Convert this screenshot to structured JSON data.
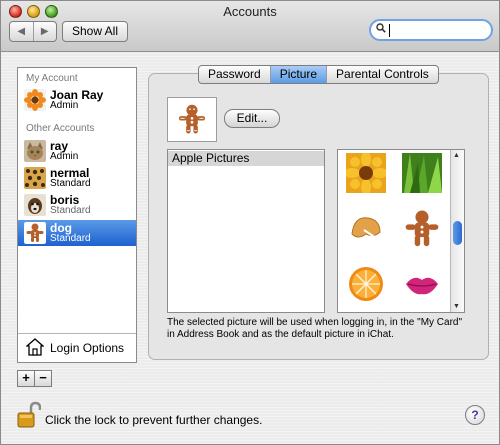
{
  "window": {
    "title": "Accounts"
  },
  "toolbar": {
    "back": "◀",
    "forward": "▶",
    "show_all": "Show All",
    "search_placeholder": ""
  },
  "sidebar": {
    "my_account_header": "My Account",
    "other_accounts_header": "Other Accounts",
    "my_account": {
      "name": "Joan Ray",
      "role": "Admin"
    },
    "accounts": [
      {
        "name": "ray",
        "role": "Admin"
      },
      {
        "name": "nermal",
        "role": "Standard"
      },
      {
        "name": "boris",
        "role": "Standard"
      },
      {
        "name": "dog",
        "role": "Standard",
        "selected": true
      }
    ],
    "login_options": "Login Options",
    "add": "+",
    "remove": "−"
  },
  "tabs": [
    {
      "label": "Password",
      "active": false
    },
    {
      "label": "Picture",
      "active": true
    },
    {
      "label": "Parental Controls",
      "active": false
    }
  ],
  "picture": {
    "edit_label": "Edit...",
    "source_list": [
      "Apple Pictures"
    ],
    "images": [
      "sunflower",
      "grass",
      "fortune-cookie",
      "gingerbread-man",
      "orange-slice",
      "lips"
    ],
    "note": "The selected picture will be used when logging in, in the \"My Card\" in Address Book and as the default picture in iChat."
  },
  "footer": {
    "lock_text": "Click the lock to prevent further changes.",
    "help": "?"
  },
  "colors": {
    "selection": "#1d62cf",
    "focus_ring": "#6da3e4"
  }
}
